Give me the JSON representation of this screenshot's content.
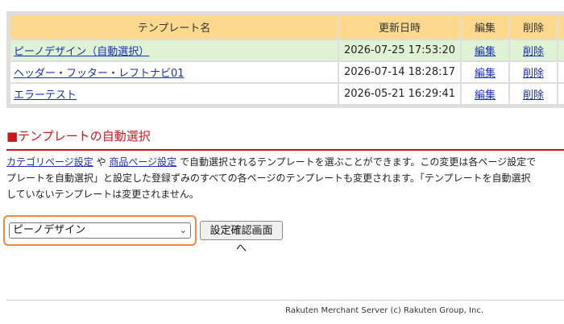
{
  "table": {
    "headers": [
      "テンプレート名",
      "更新日時",
      "編集",
      "削除"
    ],
    "rows": [
      {
        "name": "ピーノデザイン（自動選択）",
        "date": "2026-07-25 17:53:20",
        "edit": "編集",
        "delete": "削除",
        "selected": true
      },
      {
        "name": "ヘッダー・フッター・レフトナビ01",
        "date": "2026-07-14 18:28:17",
        "edit": "編集",
        "delete": "削除",
        "selected": false
      },
      {
        "name": "エラーテスト",
        "date": "2026-05-21 16:29:41",
        "edit": "編集",
        "delete": "削除",
        "selected": false
      }
    ]
  },
  "section": {
    "title": "■テンプレートの自動選択"
  },
  "description": {
    "link1": "カテゴリページ設定",
    "sep": " や ",
    "link2": "商品ページ設定",
    "line1_rest": " で自動選択されるテンプレートを選ぶことができます。この変更は各ページ設定で",
    "line2": "プレートを自動選択」と設定した登録ずみのすべての各ページのテンプレートも変更されます。「テンプレートを自動選択",
    "line3": "していないテンプレートは変更されません。"
  },
  "select": {
    "value": "ピーノデザイン"
  },
  "button": {
    "label": "設定確認画面へ"
  },
  "footer": {
    "text": "Rakuten Merchant Server (c) Rakuten Group, Inc."
  },
  "colors": {
    "header_bg": "#fcd98c",
    "selected_row_bg": "#dff2d3",
    "accent_red": "#c8161d",
    "highlight_orange": "#ef8a3c",
    "link": "#1a2fb8"
  }
}
